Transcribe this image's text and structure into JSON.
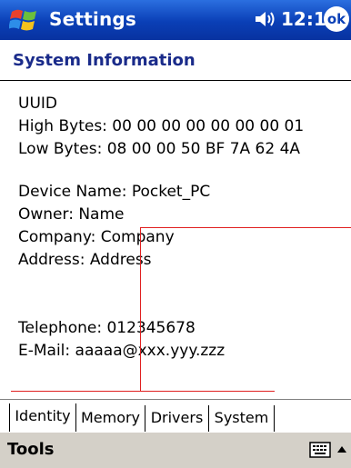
{
  "titlebar": {
    "title": "Settings",
    "time": "12:15",
    "ok_label": "ok",
    "start_icon": "windows-flag-icon",
    "speaker_icon": "speaker-icon"
  },
  "page": {
    "heading": "System Information"
  },
  "identity": {
    "uuid_label": "UUID",
    "high_bytes": "High Bytes: 00 00 00 00 00 00 00 01",
    "low_bytes": "Low Bytes: 08 00 00 50 BF 7A 62 4A",
    "device_name": "Device Name: Pocket_PC",
    "owner": "Owner: Name",
    "company": "Company: Company",
    "address": "Address: Address",
    "telephone": "Telephone: 012345678",
    "email": "E-Mail: aaaaa@xxx.yyy.zzz"
  },
  "tabs": [
    {
      "label": "Identity"
    },
    {
      "label": "Memory"
    },
    {
      "label": "Drivers"
    },
    {
      "label": "System"
    }
  ],
  "cmdbar": {
    "tools_label": "Tools",
    "keyboard_icon": "keyboard-icon",
    "arrow_icon": "up-arrow-icon"
  },
  "colors": {
    "titlebar": "#0a3fb6",
    "heading": "#1a2b8a",
    "annotation_lines": "#e02020",
    "cmdbar": "#d4d0c8"
  }
}
